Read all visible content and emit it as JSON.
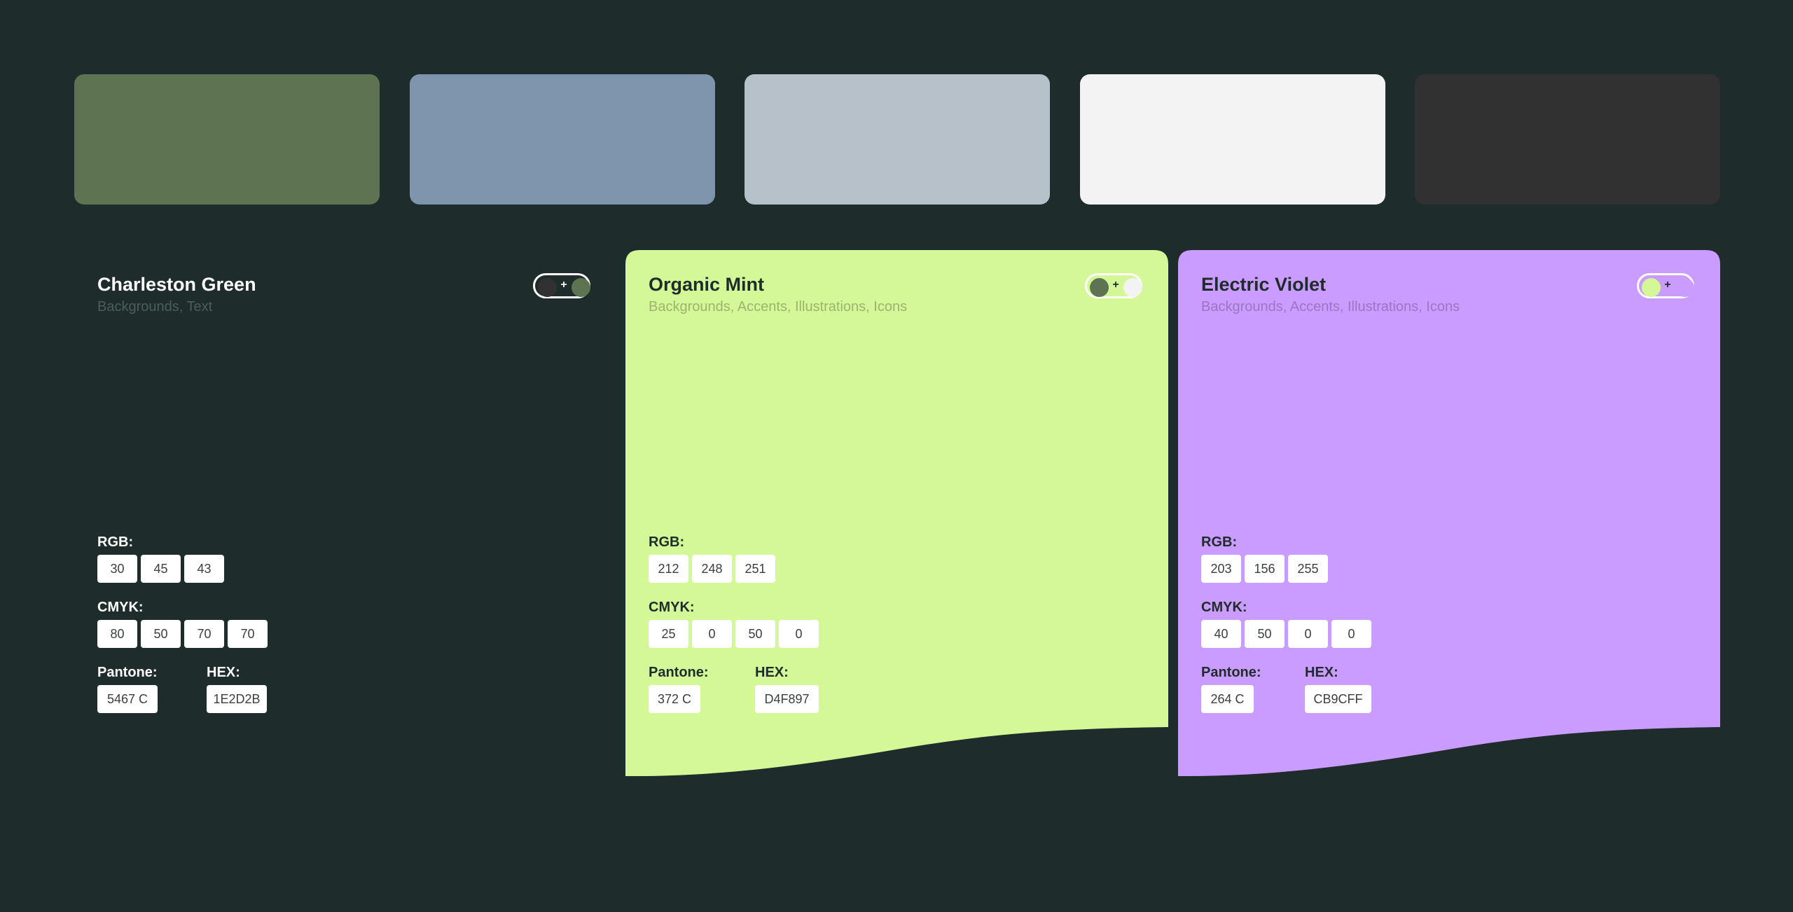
{
  "swatches": [
    {
      "name": "swatch-moss",
      "color": "#5E7352"
    },
    {
      "name": "swatch-slate-blue",
      "color": "#7F95AE"
    },
    {
      "name": "swatch-cloud-grey",
      "color": "#B6C1CA"
    },
    {
      "name": "swatch-off-white",
      "color": "#F3F3F3"
    },
    {
      "name": "swatch-charcoal",
      "color": "#313131"
    }
  ],
  "cards": [
    {
      "title": "Charleston Green",
      "subtitle": "Backgrounds, Text",
      "background": "#1E2D2B",
      "text_color": "#FFFFFF",
      "subtitle_color": "#4B5E5B",
      "toggle": {
        "dot_a": "#313131",
        "dot_b": "#5E7352",
        "plus": "+"
      },
      "rgb_label": "RGB:",
      "rgb": [
        "30",
        "45",
        "43"
      ],
      "cmyk_label": "CMYK:",
      "cmyk": [
        "80",
        "50",
        "70",
        "70"
      ],
      "pantone_label": "Pantone:",
      "pantone": "5467 C",
      "hex_label": "HEX:",
      "hex": "1E2D2B"
    },
    {
      "title": "Organic Mint",
      "subtitle": "Backgrounds, Accents, Illustrations, Icons",
      "background": "#D4F897",
      "text_color": "#1E2D2B",
      "subtitle_color": "#9DB36F",
      "toggle": {
        "dot_a": "#5E7352",
        "dot_b": "#F3F3F3",
        "plus": "+"
      },
      "rgb_label": "RGB:",
      "rgb": [
        "212",
        "248",
        "251"
      ],
      "cmyk_label": "CMYK:",
      "cmyk": [
        "25",
        "0",
        "50",
        "0"
      ],
      "pantone_label": "Pantone:",
      "pantone": "372 C",
      "hex_label": "HEX:",
      "hex": "D4F897"
    },
    {
      "title": "Electric Violet",
      "subtitle": "Backgrounds, Accents, Illustrations, Icons",
      "background": "#CB9CFF",
      "text_color": "#1E2D2B",
      "subtitle_color": "#9A76C4",
      "toggle": {
        "dot_a": "#D4F897",
        "dot_b": "#CB9CFF",
        "plus": "+"
      },
      "rgb_label": "RGB:",
      "rgb": [
        "203",
        "156",
        "255"
      ],
      "cmyk_label": "CMYK:",
      "cmyk": [
        "40",
        "50",
        "0",
        "0"
      ],
      "pantone_label": "Pantone:",
      "pantone": "264 C",
      "hex_label": "HEX:",
      "hex": "CB9CFF"
    }
  ]
}
